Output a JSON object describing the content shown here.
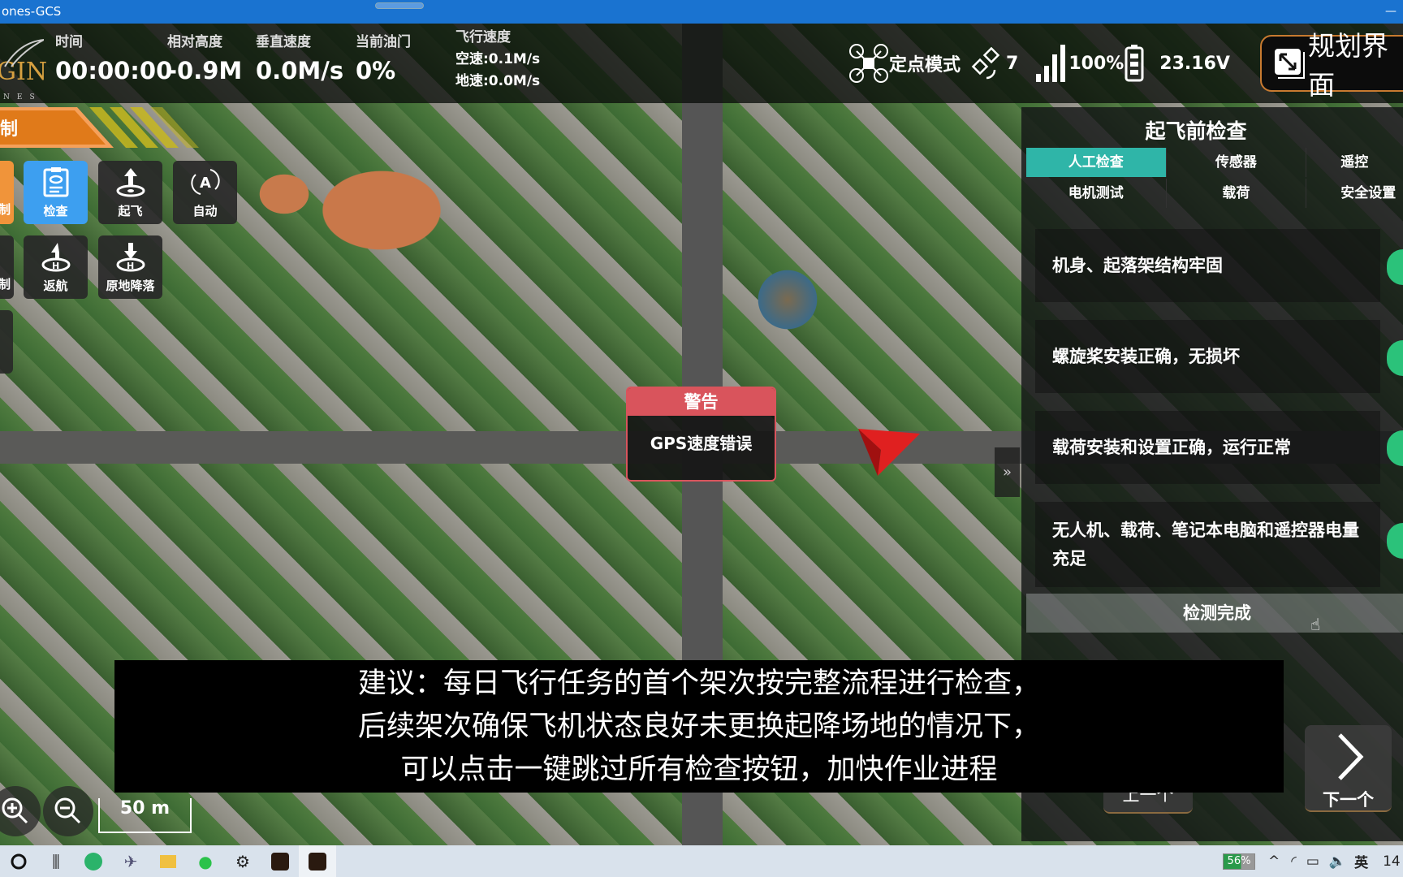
{
  "window": {
    "title": "ones-GCS"
  },
  "hud": {
    "logo": "GIN",
    "logo_sub": "NES",
    "stats": [
      {
        "label": "时间",
        "value": "00:00:00"
      },
      {
        "label": "相对高度",
        "value": "-0.9M"
      },
      {
        "label": "垂直速度",
        "value": "0.0M/s"
      },
      {
        "label": "当前油门",
        "value": "0%"
      }
    ],
    "speed": {
      "label": "飞行速度",
      "air": "空速:0.1M/s",
      "ground": "地速:0.0M/s"
    },
    "mode": "定点模式",
    "satellites": "7",
    "signal": "100%",
    "voltage": "23.16V",
    "plan_button": "规划界面"
  },
  "banner": {
    "label": "制"
  },
  "controls": [
    {
      "label": "制"
    },
    {
      "label": "检查",
      "active": true
    },
    {
      "label": "起飞"
    },
    {
      "label": "自动"
    },
    {
      "label": "制"
    },
    {
      "label": "返航"
    },
    {
      "label": "原地降落"
    }
  ],
  "warning": {
    "title": "警告",
    "message": "GPS速度错误"
  },
  "panel": {
    "title": "起飞前检查",
    "tabs": [
      "人工检查",
      "传感器",
      "遥控",
      "电机测试",
      "载荷",
      "安全设置"
    ],
    "active_tab": "人工检查",
    "items": [
      "机身、起落架结构牢固",
      "螺旋桨安装正确，无损坏",
      "载荷安装和设置正确，运行正常",
      "无人机、载荷、笔记本电脑和遥控器电量充足"
    ],
    "done_button": "检测完成",
    "prev_button": "上一个",
    "next_button": "下一个"
  },
  "subtitle": [
    "建议：每日飞行任务的首个架次按完整流程进行检查，",
    "后续架次确保飞机状态良好未更换起降场地的情况下，",
    "可以点击一键跳过所有检查按钮，加快作业进程"
  ],
  "map": {
    "scale": "50 m"
  },
  "taskbar": {
    "battery": "56%",
    "ime": "英",
    "clock": "14"
  },
  "colors": {
    "accent": "#3d9ff0",
    "tab_active": "#2fb5a8",
    "warning": "#d9545c",
    "toggle": "#2bc27a",
    "banner": "#e07a1a"
  }
}
